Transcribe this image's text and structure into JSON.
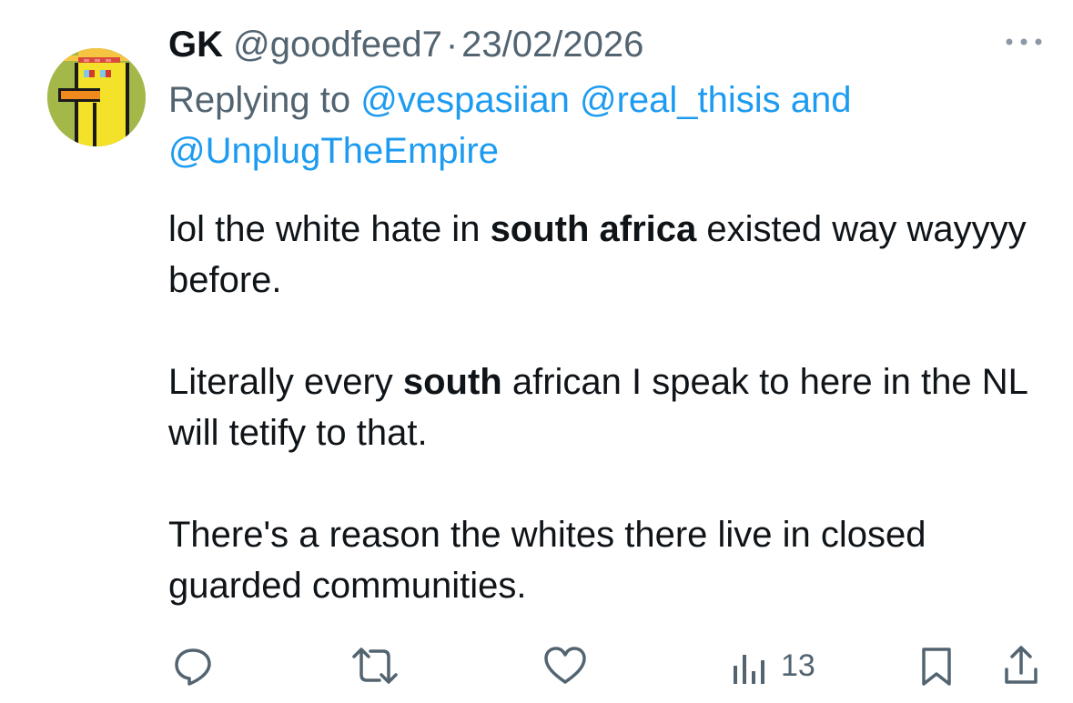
{
  "tweet": {
    "display_name": "GK",
    "handle": "@goodfeed7",
    "separator": "·",
    "date": "23/02/2026",
    "replying_prefix": "Replying to",
    "mentions": [
      "@vespasiian",
      "@real_thisis",
      "@UnplugTheEmpire"
    ],
    "mentions_joiner": "and",
    "body": {
      "p1_a": "lol the white hate in ",
      "p1_bold": "south africa",
      "p1_b": " existed way wayyyy before.",
      "p2_a": "Literally every ",
      "p2_bold": "south",
      "p2_b": " african I speak to here in the NL will tetify to that.",
      "p3": "There's a reason the whites there live in closed guarded communities."
    },
    "actions": {
      "views_count": "13"
    },
    "icons": {
      "more": "more-horizontal-icon",
      "reply": "reply-icon",
      "retweet": "retweet-icon",
      "like": "heart-icon",
      "views": "views-bar-chart-icon",
      "bookmark": "bookmark-icon",
      "share": "share-upload-icon"
    },
    "colors": {
      "text": "#0f1419",
      "secondary": "#536471",
      "link": "#1d9bf0",
      "avatar_bg": "#a4b84a"
    }
  }
}
